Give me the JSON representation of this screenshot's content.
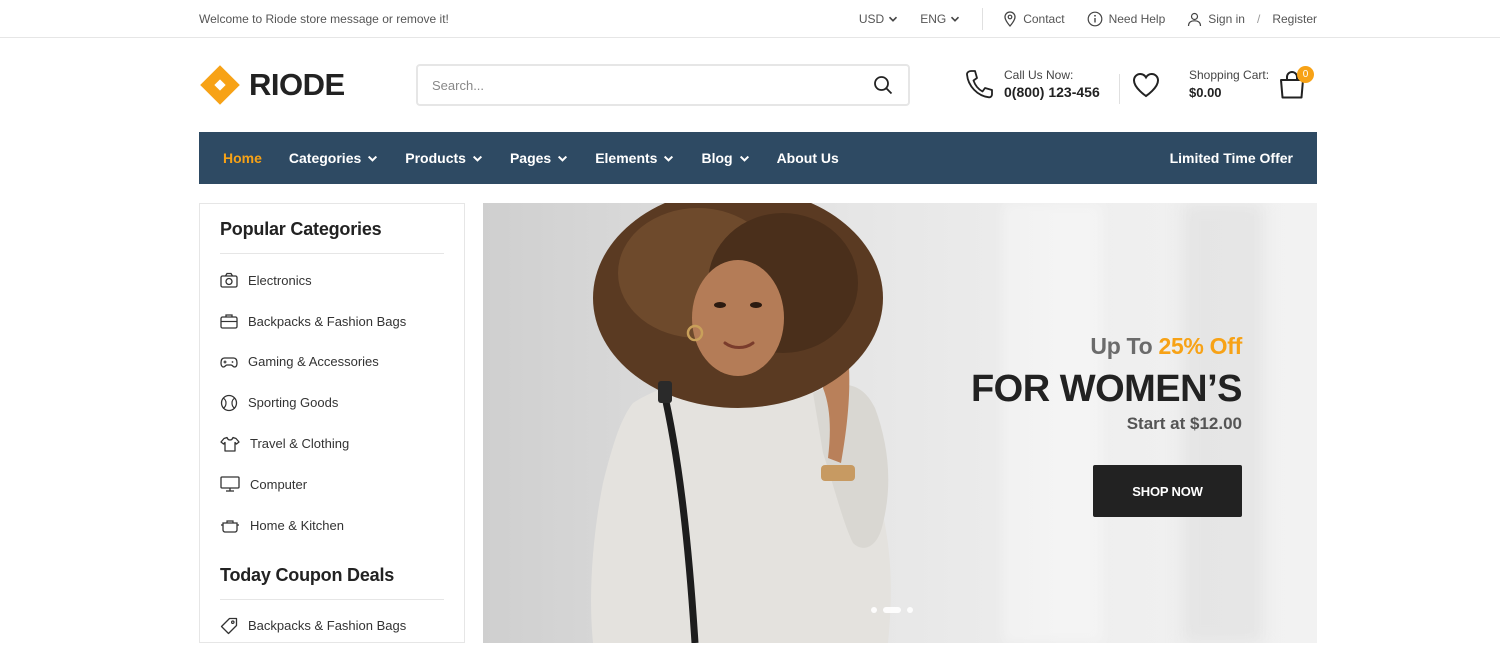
{
  "topbar": {
    "welcome": "Welcome to Riode store message or remove it!",
    "currency": "USD",
    "language": "ENG",
    "contact": "Contact",
    "help": "Need Help",
    "signin": "Sign in",
    "separator": "/",
    "register": "Register"
  },
  "header": {
    "logo": "RIODE",
    "search_placeholder": "Search...",
    "call_label": "Call Us Now:",
    "call_number": "0(800) 123-456",
    "cart_label": "Shopping Cart:",
    "cart_total": "$0.00",
    "cart_count": "0"
  },
  "nav": {
    "items": [
      {
        "label": "Home"
      },
      {
        "label": "Categories"
      },
      {
        "label": "Products"
      },
      {
        "label": "Pages"
      },
      {
        "label": "Elements"
      },
      {
        "label": "Blog"
      },
      {
        "label": "About Us"
      }
    ],
    "offer": "Limited Time Offer"
  },
  "sidebar": {
    "popular_title": "Popular Categories",
    "categories": [
      {
        "label": "Electronics",
        "icon": "camera-icon"
      },
      {
        "label": "Backpacks & Fashion Bags",
        "icon": "bag-icon"
      },
      {
        "label": "Gaming & Accessories",
        "icon": "gamepad-icon"
      },
      {
        "label": "Sporting Goods",
        "icon": "ball-icon"
      },
      {
        "label": "Travel & Clothing",
        "icon": "shirt-icon"
      },
      {
        "label": "Computer",
        "icon": "monitor-icon"
      },
      {
        "label": "Home & Kitchen",
        "icon": "pot-icon"
      }
    ],
    "coupon_title": "Today Coupon Deals",
    "coupons": [
      {
        "label": "Backpacks & Fashion Bags",
        "icon": "tag-icon"
      }
    ]
  },
  "banner": {
    "upto_prefix": "Up To",
    "upto_highlight": "25% Off",
    "title": "FOR WOMEN’S",
    "subtitle": "Start at $12.00",
    "button": "SHOP NOW"
  },
  "colors": {
    "accent": "#f7a216",
    "nav_bg": "#2e4a63",
    "button_bg": "#222222"
  }
}
